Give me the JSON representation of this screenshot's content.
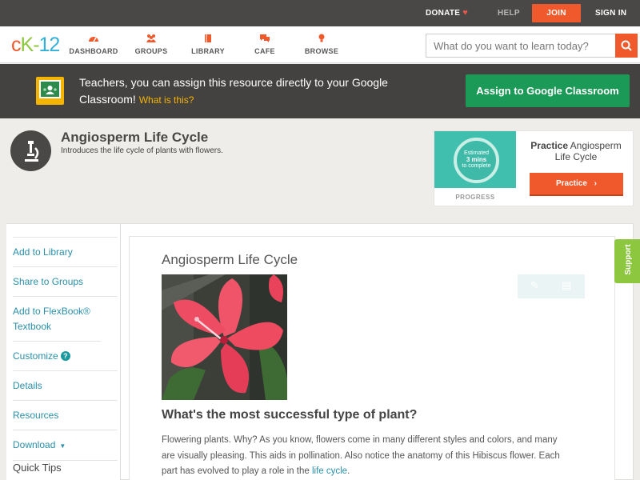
{
  "topbar": {
    "donate": "DONATE",
    "help": "HELP",
    "join": "JOIN",
    "signin": "SIGN IN"
  },
  "logo": {
    "text": "CK-12"
  },
  "nav": {
    "dashboard": "DASHBOARD",
    "groups": "GROUPS",
    "library": "LIBRARY",
    "cafe": "CAFE",
    "browse": "BROWSE"
  },
  "search": {
    "placeholder": "What do you want to learn today?"
  },
  "classroom_banner": {
    "text": "Teachers, you can assign this resource directly to your Google Classroom!",
    "what_link": "What is this?",
    "button": "Assign to Google Classroom"
  },
  "concept": {
    "title": "Angiosperm Life Cycle",
    "subtitle": "Introduces the life cycle of plants with flowers."
  },
  "practice": {
    "estimated": "Estimated",
    "mins": "3 mins",
    "complete": "to complete",
    "progress_label": "PROGRESS",
    "title_bold": "Practice",
    "title_rest": "Angiosperm Life Cycle",
    "button": "Practice"
  },
  "sidebar": {
    "items": [
      {
        "label": "Add to Library"
      },
      {
        "label": "Share to Groups"
      },
      {
        "label": "Add to FlexBook® Textbook"
      },
      {
        "label": "Customize"
      },
      {
        "label": "Details"
      },
      {
        "label": "Resources"
      },
      {
        "label": "Download"
      }
    ],
    "quick_tips": "Quick Tips"
  },
  "article": {
    "title": "Angiosperm Life Cycle",
    "heading": "What's the most successful type of plant?",
    "paragraph_start": "Flowering plants. Why? As you know, flowers come in many different styles and colors, and many are visually pleasing. This aids in pollination. Also notice the anatomy of this Hibiscus flower. Each part has evolved to play a role in the ",
    "paragraph_link": "life cycle",
    "paragraph_end": "."
  },
  "support_tab": "Support",
  "colors": {
    "accent_orange": "#f0592b",
    "classroom_green": "#1a9a56",
    "link_teal": "#2a8fa8",
    "support_green": "#8dc63f"
  },
  "icons": [
    "heart-icon",
    "dashboard-icon",
    "groups-icon",
    "library-icon",
    "cafe-icon",
    "browse-icon",
    "search-icon",
    "google-classroom-icon",
    "microscope-icon",
    "chevron-right-icon",
    "help-icon",
    "caret-down-icon",
    "pencil-icon",
    "notes-icon"
  ]
}
